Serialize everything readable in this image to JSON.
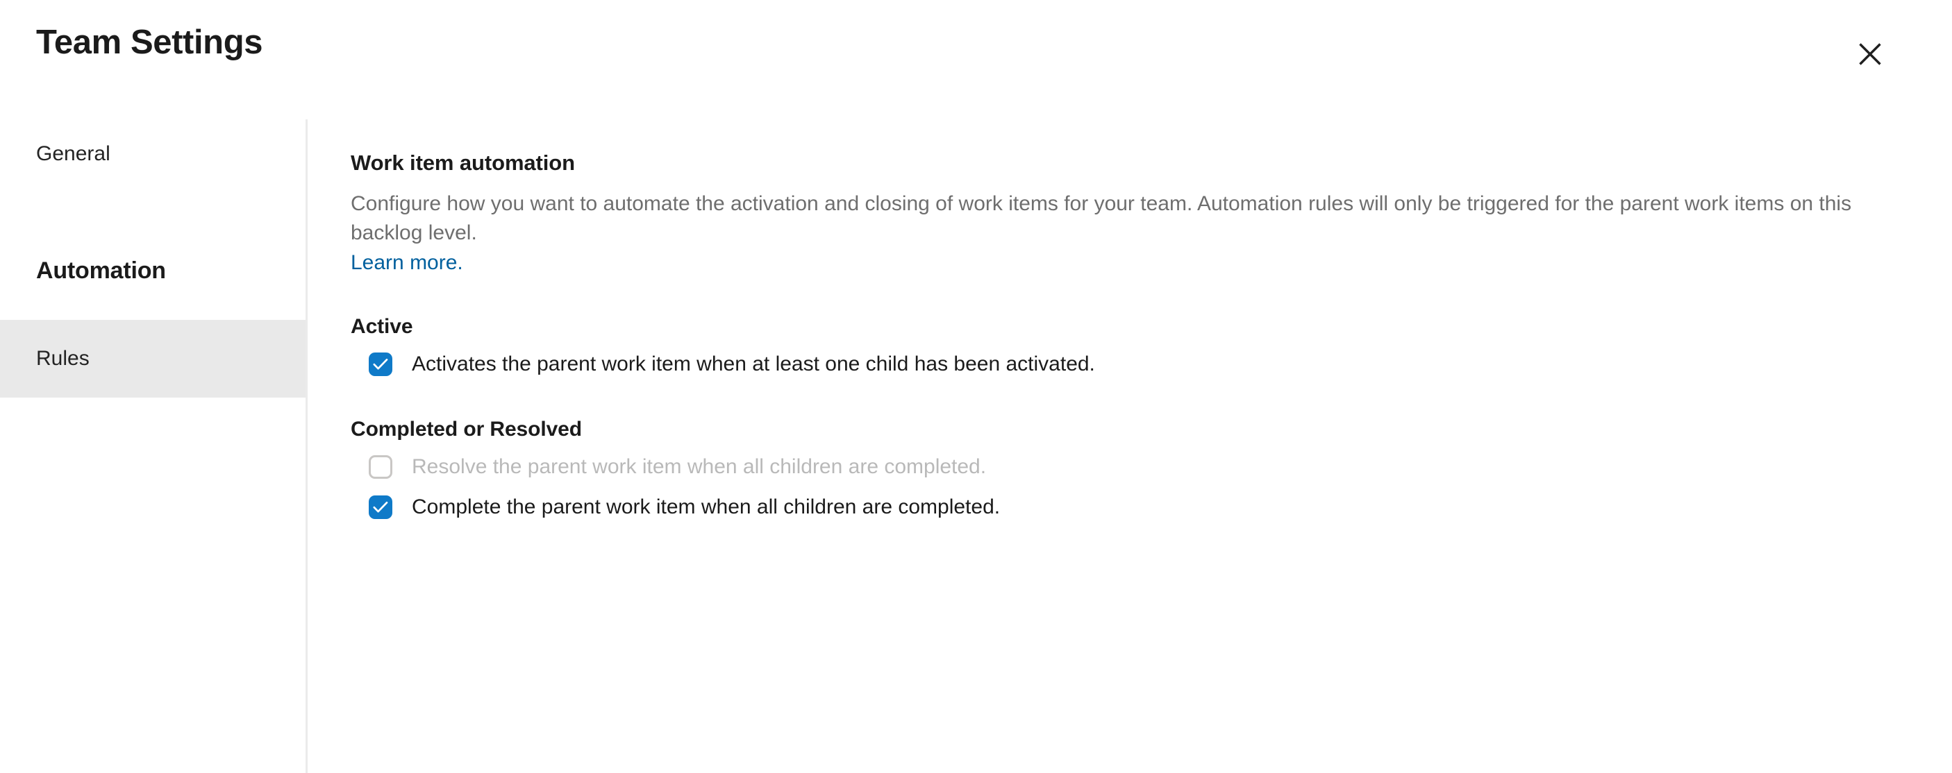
{
  "header": {
    "title": "Team Settings",
    "close_label": "Close",
    "close_icon": "close-icon"
  },
  "sidebar": {
    "items": [
      {
        "label": "General",
        "selected": false,
        "type": "link"
      },
      {
        "label": "Automation",
        "selected": false,
        "type": "group-header"
      },
      {
        "label": "Rules",
        "selected": true,
        "type": "link"
      }
    ]
  },
  "main": {
    "heading": "Work item automation",
    "description": "Configure how you want to automate the activation and closing of work items for your team. Automation rules will only be triggered for the parent work items on this backlog level.",
    "learn_more": "Learn more.",
    "groups": [
      {
        "title": "Active",
        "rules": [
          {
            "label": "Activates the parent work item when at least one child has been activated.",
            "checked": true,
            "disabled": false
          }
        ]
      },
      {
        "title": "Completed or Resolved",
        "rules": [
          {
            "label": "Resolve the parent work item when all children are completed.",
            "checked": false,
            "disabled": true
          },
          {
            "label": "Complete the parent work item when all children are completed.",
            "checked": true,
            "disabled": false
          }
        ]
      }
    ]
  },
  "colors": {
    "accent": "#0f7ac8",
    "link": "#00609e",
    "selected_row_bg": "#e9e9e9",
    "divider": "#ebebeb",
    "muted_text": "#6e6e6e",
    "disabled_text": "#b9b9b9",
    "disabled_border": "#c9c7c5",
    "text": "#1b1b1b"
  }
}
